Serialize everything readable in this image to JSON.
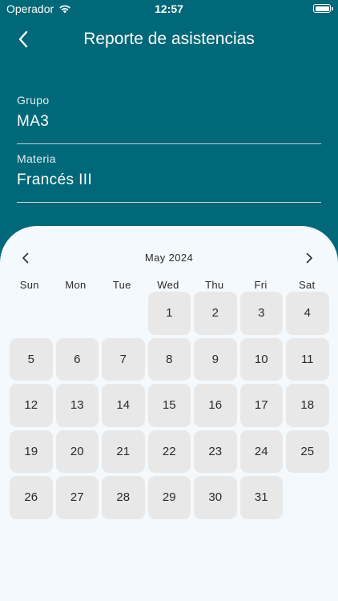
{
  "status_bar": {
    "carrier": "Operador",
    "time": "12:57"
  },
  "nav": {
    "title": "Reporte de asistencias"
  },
  "form": {
    "grupo": {
      "label": "Grupo",
      "value": "MA3"
    },
    "materia": {
      "label": "Materia",
      "value": "Francés III"
    }
  },
  "calendar": {
    "month_label": "May 2024",
    "weekdays": [
      "Sun",
      "Mon",
      "Tue",
      "Wed",
      "Thu",
      "Fri",
      "Sat"
    ],
    "first_weekday_index": 3,
    "days": [
      "1",
      "2",
      "3",
      "4",
      "5",
      "6",
      "7",
      "8",
      "9",
      "10",
      "11",
      "12",
      "13",
      "14",
      "15",
      "16",
      "17",
      "18",
      "19",
      "20",
      "21",
      "22",
      "23",
      "24",
      "25",
      "26",
      "27",
      "28",
      "29",
      "30",
      "31"
    ]
  },
  "colors": {
    "header_bg": "#006878",
    "sheet_bg": "#f3f9fd",
    "day_bg": "#e8e8e8",
    "text_dark": "#2b2b2b"
  },
  "icons": {
    "back": "chevron-left-icon",
    "prev_month": "chevron-left-icon",
    "next_month": "chevron-right-icon",
    "wifi": "wifi-icon",
    "battery": "battery-icon"
  }
}
